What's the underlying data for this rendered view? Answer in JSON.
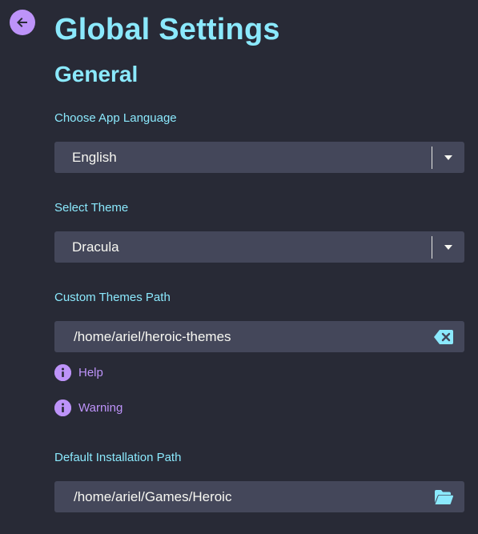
{
  "header": {
    "title": "Global Settings",
    "subtitle": "General"
  },
  "settings": {
    "language": {
      "label": "Choose App Language",
      "value": "English"
    },
    "theme": {
      "label": "Select Theme",
      "value": "Dracula"
    },
    "custom_themes_path": {
      "label": "Custom Themes Path",
      "value": "/home/ariel/heroic-themes",
      "help": "Help",
      "warning": "Warning"
    },
    "default_install_path": {
      "label": "Default Installation Path",
      "value": "/home/ariel/Games/Heroic"
    }
  },
  "icons": {
    "back": "arrow-left-icon",
    "caret": "chevron-down-icon",
    "clear": "backspace-icon",
    "folder": "folder-open-icon",
    "info": "info-circle-icon"
  },
  "colors": {
    "background": "#282a36",
    "field": "#44475a",
    "accent_cyan": "#8be9fd",
    "accent_purple": "#bd93f9",
    "text": "#f8f8f2"
  }
}
